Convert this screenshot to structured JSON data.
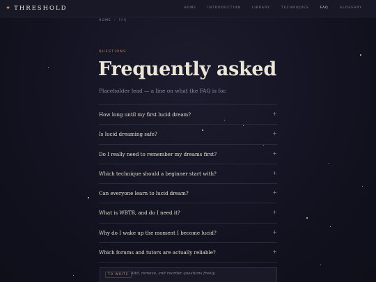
{
  "brand": {
    "name": "THRESHOLD"
  },
  "nav": {
    "items": [
      {
        "label": "HOME",
        "active": false
      },
      {
        "label": "INTRODUCTION",
        "active": false
      },
      {
        "label": "LIBRARY",
        "active": false
      },
      {
        "label": "TECHNIQUES",
        "active": false
      },
      {
        "label": "FAQ",
        "active": true
      },
      {
        "label": "GLOSSARY",
        "active": false
      }
    ]
  },
  "breadcrumb": {
    "home": "HOME",
    "sep": "/",
    "current": "FAQ"
  },
  "header": {
    "eyebrow": "QUESTIONS",
    "title": "Frequently asked",
    "lead": "Placeholder lead — a line on what the FAQ is for."
  },
  "faq": {
    "items": [
      {
        "question": "How long until my first lucid dream?",
        "expand": "+"
      },
      {
        "question": "Is lucid dreaming safe?",
        "expand": "+"
      },
      {
        "question": "Do I really need to remember my dreams first?",
        "expand": "+"
      },
      {
        "question": "Which technique should a beginner start with?",
        "expand": "+"
      },
      {
        "question": "Can everyone learn to lucid dream?",
        "expand": "+"
      },
      {
        "question": "What is WBTB, and do I need it?",
        "expand": "+"
      },
      {
        "question": "Why do I wake up the moment I become lucid?",
        "expand": "+"
      },
      {
        "question": "Which forums and tutors are actually reliable?",
        "expand": "+"
      }
    ]
  },
  "note": {
    "tag": "TO WRITE",
    "text": "Add, remove, and reorder questions freely."
  },
  "colors": {
    "accent": "#c7905a",
    "background": "#13131f",
    "text": "#ece6d8"
  }
}
